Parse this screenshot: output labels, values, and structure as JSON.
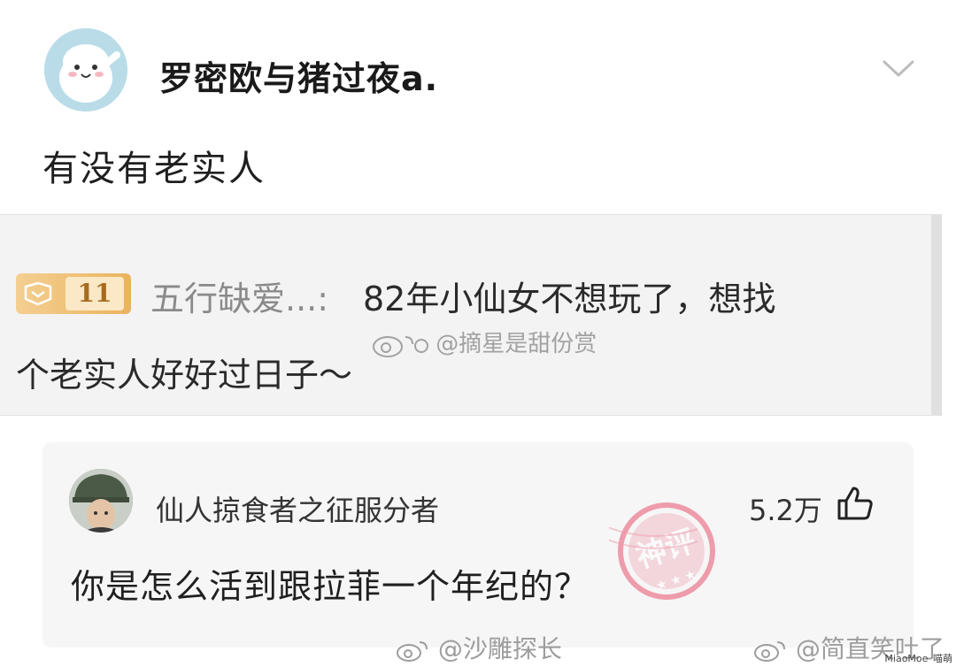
{
  "post": {
    "username": "罗密欧与猪过夜a.",
    "text": "有没有老实人"
  },
  "quote": {
    "level": "11",
    "name": "五行缺爱...:",
    "line1": "82年小仙女不想玩了，想找",
    "line2": "个老实人好好过日子～",
    "watermark": "@摘星是甜份赏"
  },
  "comment": {
    "username": "仙人掠食者之征服分者",
    "likes": "5.2万",
    "text": "你是怎么活到跟拉菲一个年纪的？",
    "stamp": "神评"
  },
  "watermarks": {
    "left": "@沙雕探长",
    "right": "@简直笑吐了",
    "site": "MiaoMoe",
    "site_sub": "喵萌"
  },
  "colors": {
    "badge_gold": "#eab35d",
    "stamp_red": "#e8546f",
    "watermark_gray": "#9d9d9d"
  },
  "icons": {
    "chevron": "chevron-down-icon",
    "like": "thumbs-up-icon",
    "badge": "fan-badge-icon",
    "weibo": "weibo-logo-icon"
  }
}
